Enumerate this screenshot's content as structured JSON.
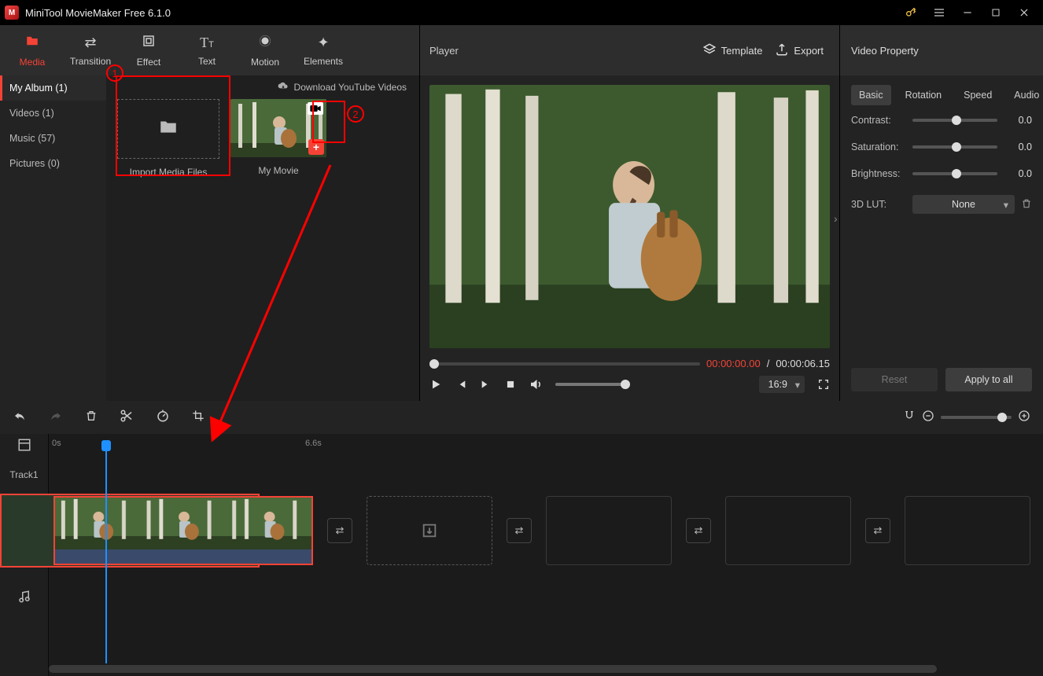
{
  "titlebar": {
    "title": "MiniTool MovieMaker Free 6.1.0"
  },
  "tabs": {
    "media": "Media",
    "transition": "Transition",
    "effect": "Effect",
    "text": "Text",
    "motion": "Motion",
    "elements": "Elements"
  },
  "albums": {
    "my_album": "My Album (1)",
    "videos": "Videos (1)",
    "music": "Music (57)",
    "pictures": "Pictures (0)"
  },
  "download_yt": "Download YouTube Videos",
  "import_label": "Import Media Files",
  "movie_label": "My Movie",
  "ann1": "1",
  "ann2": "2",
  "player": {
    "title": "Player",
    "template": "Template",
    "export": "Export",
    "time_cur": "00:00:00.00",
    "time_sep": "/",
    "time_dur": "00:00:06.15",
    "ratio": "16:9"
  },
  "prop": {
    "title": "Video Property",
    "tabs": {
      "basic": "Basic",
      "rotation": "Rotation",
      "speed": "Speed",
      "audio": "Audio"
    },
    "contrast_lbl": "Contrast:",
    "saturation_lbl": "Saturation:",
    "brightness_lbl": "Brightness:",
    "lut_lbl": "3D LUT:",
    "lut_val": "None",
    "val0": "0.0",
    "reset": "Reset",
    "apply": "Apply to all"
  },
  "timeline": {
    "t0": "0s",
    "t1": "6.6s",
    "track": "Track1"
  }
}
